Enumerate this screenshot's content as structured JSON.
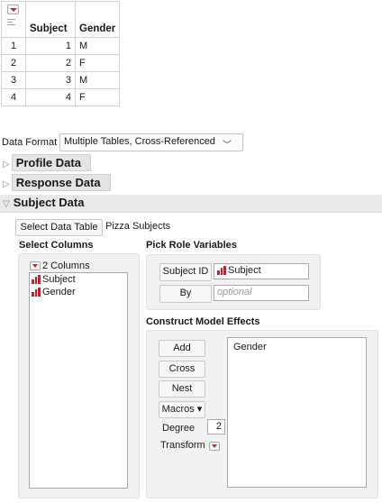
{
  "grid": {
    "columns": [
      "Subject",
      "Gender"
    ],
    "rows": [
      {
        "row": "1",
        "subject": "1",
        "gender": "M"
      },
      {
        "row": "2",
        "subject": "2",
        "gender": "F"
      },
      {
        "row": "3",
        "subject": "3",
        "gender": "M"
      },
      {
        "row": "4",
        "subject": "4",
        "gender": "F"
      }
    ]
  },
  "platform": {
    "data_format_label": "Data Format",
    "data_format_value": "Multiple Tables, Cross-Referenced",
    "sections": {
      "profile": "Profile Data",
      "response": "Response Data",
      "subject": "Subject Data"
    },
    "select_data_table_label": "Select Data Table",
    "data_table_name": "Pizza Subjects",
    "select_columns_label": "Select Columns",
    "column_count": "2 Columns",
    "columns": [
      "Subject",
      "Gender"
    ],
    "pick_role_label": "Pick Role Variables",
    "subject_id_label": "Subject ID",
    "subject_id_value": "Subject",
    "by_label": "By",
    "by_placeholder": "optional",
    "construct_label": "Construct Model Effects",
    "add_label": "Add",
    "cross_label": "Cross",
    "nest_label": "Nest",
    "macros_label": "Macros",
    "degree_label": "Degree",
    "degree_value": "2",
    "transform_label": "Transform",
    "effects": [
      "Gender"
    ]
  },
  "colors": {
    "accent_red": "#d22222",
    "section_bg": "#e4e4e4",
    "panel_bg": "#f1f1f1"
  },
  "icons": {
    "red_triangle": "red-triangle-menu-icon",
    "nominal_bars": "nominal-column-icon",
    "disclosure": "disclosure-triangle-icon"
  }
}
